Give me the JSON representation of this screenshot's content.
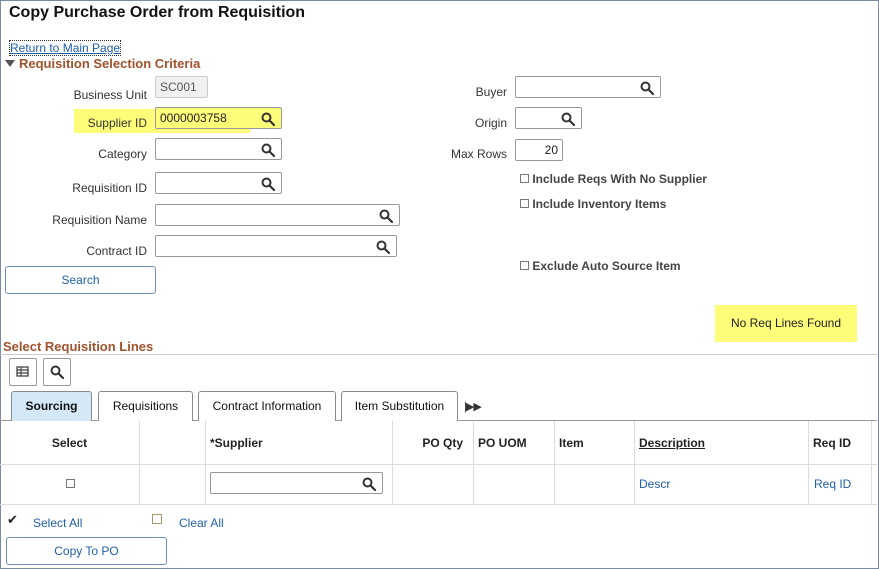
{
  "page": {
    "title": "Copy Purchase Order from Requisition",
    "return_link": "Return to Main Page"
  },
  "criteria": {
    "section_title": "Requisition Selection Criteria",
    "business_unit": {
      "label": "Business Unit",
      "value": "SC001"
    },
    "supplier_id": {
      "label": "Supplier ID",
      "value": "0000003758"
    },
    "category": {
      "label": "Category",
      "value": ""
    },
    "requisition_id": {
      "label": "Requisition ID",
      "value": ""
    },
    "requisition_name": {
      "label": "Requisition Name",
      "value": ""
    },
    "contract_id": {
      "label": "Contract ID",
      "value": ""
    },
    "buyer": {
      "label": "Buyer",
      "value": ""
    },
    "origin": {
      "label": "Origin",
      "value": ""
    },
    "max_rows": {
      "label": "Max Rows",
      "value": "20"
    },
    "include_no_supplier": "Include Reqs With No Supplier",
    "include_inventory": "Include Inventory Items",
    "exclude_auto_source": "Exclude Auto Source Item",
    "search_button": "Search",
    "message": "No Req Lines Found"
  },
  "lines": {
    "section_title": "Select Requisition Lines",
    "tabs": [
      "Sourcing",
      "Requisitions",
      "Contract Information",
      "Item Substitution"
    ],
    "active_tab": "Sourcing",
    "columns": [
      "Select",
      "",
      "*Supplier",
      "PO Qty",
      "PO UOM",
      "Item",
      "Description",
      "Req ID"
    ],
    "row": {
      "description_link": "Descr",
      "req_id_link": "Req ID",
      "supplier": ""
    },
    "select_all": "Select All",
    "clear_all": "Clear All",
    "copy_button": "Copy To PO"
  },
  "icons": {
    "search": "search-icon",
    "grid_personalize": "grid-settings-icon",
    "find": "find-icon",
    "more_tabs": "show-all-columns-icon"
  }
}
